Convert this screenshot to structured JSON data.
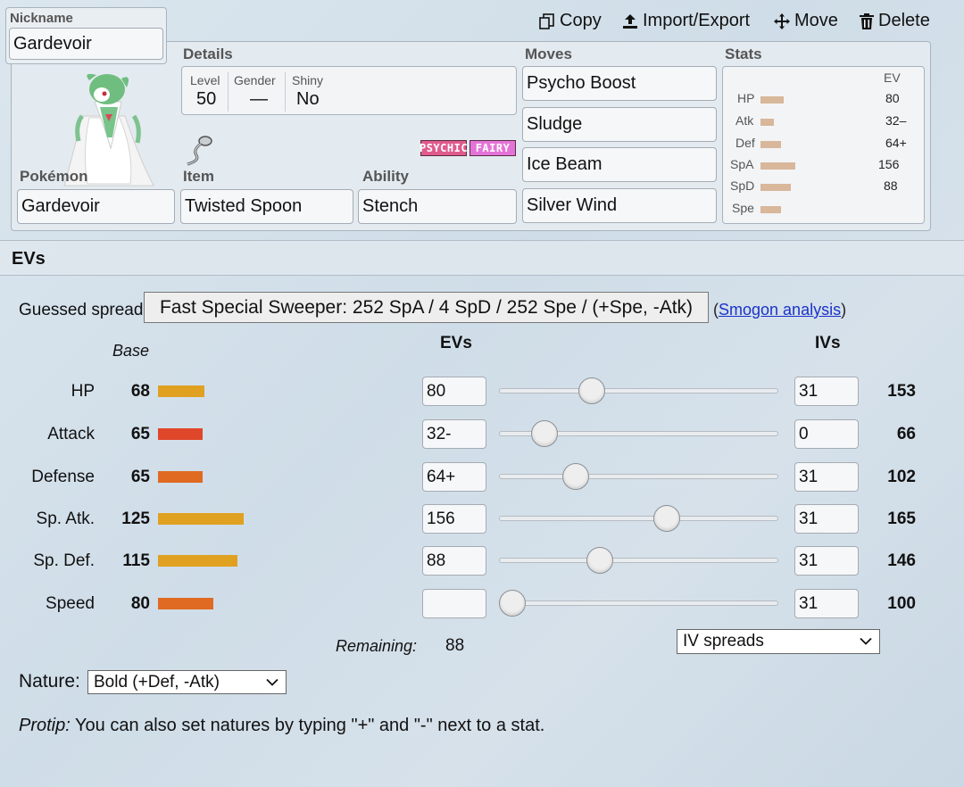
{
  "toolbar": {
    "copy": "Copy",
    "import_export": "Import/Export",
    "move": "Move",
    "delete": "Delete"
  },
  "nickname": {
    "label": "Nickname",
    "value": "Gardevoir"
  },
  "details": {
    "label": "Details",
    "level_label": "Level",
    "level": "50",
    "gender_label": "Gender",
    "gender": "—",
    "shiny_label": "Shiny",
    "shiny": "No"
  },
  "types": [
    "PSYCHIC",
    "FAIRY"
  ],
  "type_colors": {
    "psychic": "#e05a8c",
    "fairy": "#e473d8"
  },
  "pokemon": {
    "label": "Pokémon",
    "value": "Gardevoir"
  },
  "item": {
    "label": "Item",
    "value": "Twisted Spoon"
  },
  "ability": {
    "label": "Ability",
    "value": "Stench"
  },
  "moves": {
    "label": "Moves",
    "list": [
      "Psycho Boost",
      "Sludge",
      "Ice Beam",
      "Silver Wind"
    ]
  },
  "stats_panel": {
    "label": "Stats",
    "ev_header": "EV",
    "rows": [
      {
        "name": "HP",
        "ev": "80"
      },
      {
        "name": "Atk",
        "ev": "32–"
      },
      {
        "name": "Def",
        "ev": "64+"
      },
      {
        "name": "SpA",
        "ev": "156"
      },
      {
        "name": "SpD",
        "ev": "88"
      },
      {
        "name": "Spe",
        "ev": ""
      }
    ]
  },
  "evs_section": {
    "title": "EVs",
    "guessed_label": "Guessed spread:",
    "guessed_button": "Fast Special Sweeper: 252 SpA / 4 SpD / 252 Spe / (+Spe, -Atk)",
    "open_paren": "(",
    "smogon_link": "Smogon analysis",
    "close_paren": ")",
    "base_header": "Base",
    "evs_header": "EVs",
    "ivs_header": "IVs",
    "stats": [
      {
        "name": "HP",
        "base": "68",
        "ev": "80",
        "iv": "31",
        "total": "153",
        "slider": 0.3137,
        "bar_color": "#e0a020"
      },
      {
        "name": "Attack",
        "base": "65",
        "ev": "32-",
        "iv": "0",
        "total": "66",
        "slider": 0.1255,
        "bar_color": "#e0462a"
      },
      {
        "name": "Defense",
        "base": "65",
        "ev": "64+",
        "iv": "31",
        "total": "102",
        "slider": 0.251,
        "bar_color": "#e06a22"
      },
      {
        "name": "Sp. Atk.",
        "base": "125",
        "ev": "156",
        "iv": "31",
        "total": "165",
        "slider": 0.6118,
        "bar_color": "#e0a020"
      },
      {
        "name": "Sp. Def.",
        "base": "115",
        "ev": "88",
        "iv": "31",
        "total": "146",
        "slider": 0.3451,
        "bar_color": "#e0a020"
      },
      {
        "name": "Speed",
        "base": "80",
        "ev": "",
        "iv": "31",
        "total": "100",
        "slider": 0.0,
        "bar_color": "#e06a22"
      }
    ],
    "remaining_label": "Remaining:",
    "remaining_value": "88",
    "iv_spreads": "IV spreads",
    "nature_label": "Nature:",
    "nature_value": "Bold (+Def, -Atk)",
    "protip_label": "Protip:",
    "protip_text": " You can also set natures by typing \"+\" and \"-\" next to a stat."
  }
}
